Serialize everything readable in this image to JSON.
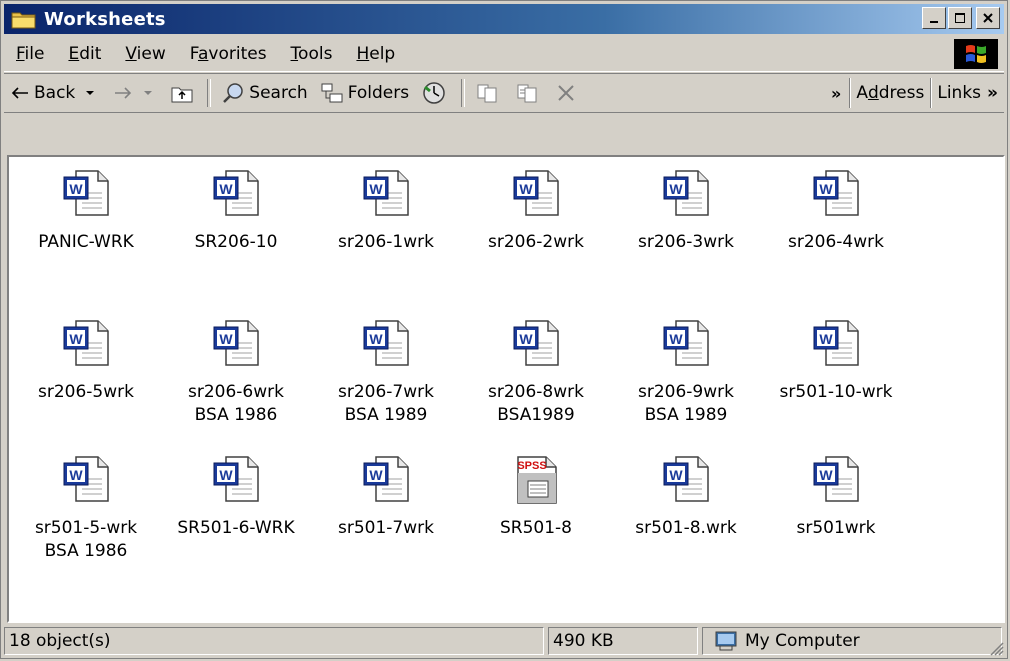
{
  "window": {
    "title": "Worksheets",
    "title_icon": "folder-icon",
    "controls": [
      "minimize",
      "maximize",
      "close"
    ]
  },
  "menu": {
    "items": [
      {
        "pre": "",
        "acc": "F",
        "post": "ile"
      },
      {
        "pre": "",
        "acc": "E",
        "post": "dit"
      },
      {
        "pre": "",
        "acc": "V",
        "post": "iew"
      },
      {
        "pre": "F",
        "acc": "a",
        "post": "vorites"
      },
      {
        "pre": "",
        "acc": "T",
        "post": "ools"
      },
      {
        "pre": "",
        "acc": "H",
        "post": "elp"
      }
    ]
  },
  "toolbar": {
    "back": "Back",
    "search": "Search",
    "folders": "Folders",
    "chevron": "»",
    "address_pre": "A",
    "address_acc": "d",
    "address_post": "dress",
    "links": "Links",
    "links_chevron": "»"
  },
  "files": [
    {
      "label": "PANIC-WRK",
      "type": "word"
    },
    {
      "label": "SR206-10",
      "type": "word"
    },
    {
      "label": "sr206-1wrk",
      "type": "word"
    },
    {
      "label": "sr206-2wrk",
      "type": "word"
    },
    {
      "label": "sr206-3wrk",
      "type": "word"
    },
    {
      "label": "sr206-4wrk",
      "type": "word"
    },
    {
      "label": "sr206-5wrk",
      "type": "word"
    },
    {
      "label": "sr206-6wrk\nBSA 1986",
      "type": "word"
    },
    {
      "label": "sr206-7wrk\nBSA 1989",
      "type": "word"
    },
    {
      "label": "sr206-8wrk\nBSA1989",
      "type": "word"
    },
    {
      "label": "sr206-9wrk\nBSA 1989",
      "type": "word"
    },
    {
      "label": "sr501-10-wrk",
      "type": "word"
    },
    {
      "label": "sr501-5-wrk\nBSA 1986",
      "type": "word"
    },
    {
      "label": "SR501-6-WRK",
      "type": "word"
    },
    {
      "label": "sr501-7wrk",
      "type": "word"
    },
    {
      "label": "SR501-8",
      "type": "spss"
    },
    {
      "label": "sr501-8.wrk",
      "type": "word"
    },
    {
      "label": "sr501wrk",
      "type": "word"
    }
  ],
  "icons": {
    "word_badge": "W",
    "spss_badge": "SPSS"
  },
  "statusbar": {
    "objects": "18 object(s)",
    "size": "490 KB",
    "zone": "My Computer"
  },
  "colors": {
    "title_start": "#0a246a",
    "title_end": "#a6caf0",
    "word_blue": "#1a3a9a"
  }
}
